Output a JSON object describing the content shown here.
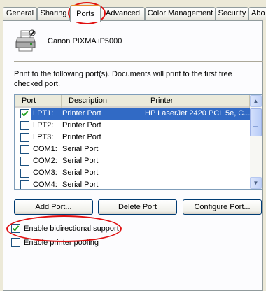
{
  "tabs": [
    {
      "label": "General",
      "active": false
    },
    {
      "label": "Sharing",
      "active": false
    },
    {
      "label": "Ports",
      "active": true
    },
    {
      "label": "Advanced",
      "active": false
    },
    {
      "label": "Color Management",
      "active": false
    },
    {
      "label": "Security",
      "active": false
    },
    {
      "label": "Abo",
      "active": false
    }
  ],
  "printer": {
    "name": "Canon PIXMA iP5000",
    "icon": "printer-icon"
  },
  "intro_text": "Print to the following port(s). Documents will print to the first free checked port.",
  "ports_list": {
    "columns": [
      "Port",
      "Description",
      "Printer"
    ],
    "rows": [
      {
        "checked": true,
        "port": "LPT1:",
        "description": "Printer Port",
        "printer": "HP LaserJet 2420 PCL 5e, C...",
        "selected": true
      },
      {
        "checked": false,
        "port": "LPT2:",
        "description": "Printer Port",
        "printer": "",
        "selected": false
      },
      {
        "checked": false,
        "port": "LPT3:",
        "description": "Printer Port",
        "printer": "",
        "selected": false
      },
      {
        "checked": false,
        "port": "COM1:",
        "description": "Serial Port",
        "printer": "",
        "selected": false
      },
      {
        "checked": false,
        "port": "COM2:",
        "description": "Serial Port",
        "printer": "",
        "selected": false
      },
      {
        "checked": false,
        "port": "COM3:",
        "description": "Serial Port",
        "printer": "",
        "selected": false
      },
      {
        "checked": false,
        "port": "COM4:",
        "description": "Serial Port",
        "printer": "",
        "selected": false
      }
    ]
  },
  "buttons": {
    "add_port": "Add Port...",
    "delete_port": "Delete Port",
    "configure_port": "Configure Port..."
  },
  "options": {
    "bidirectional": {
      "label": "Enable bidirectional support",
      "checked": true
    },
    "pooling": {
      "label": "Enable printer pooling",
      "checked": false
    }
  },
  "colors": {
    "selection": "#316ac5",
    "highlight_circle": "#e01010",
    "active_tab_accent": "#e68b2c"
  }
}
